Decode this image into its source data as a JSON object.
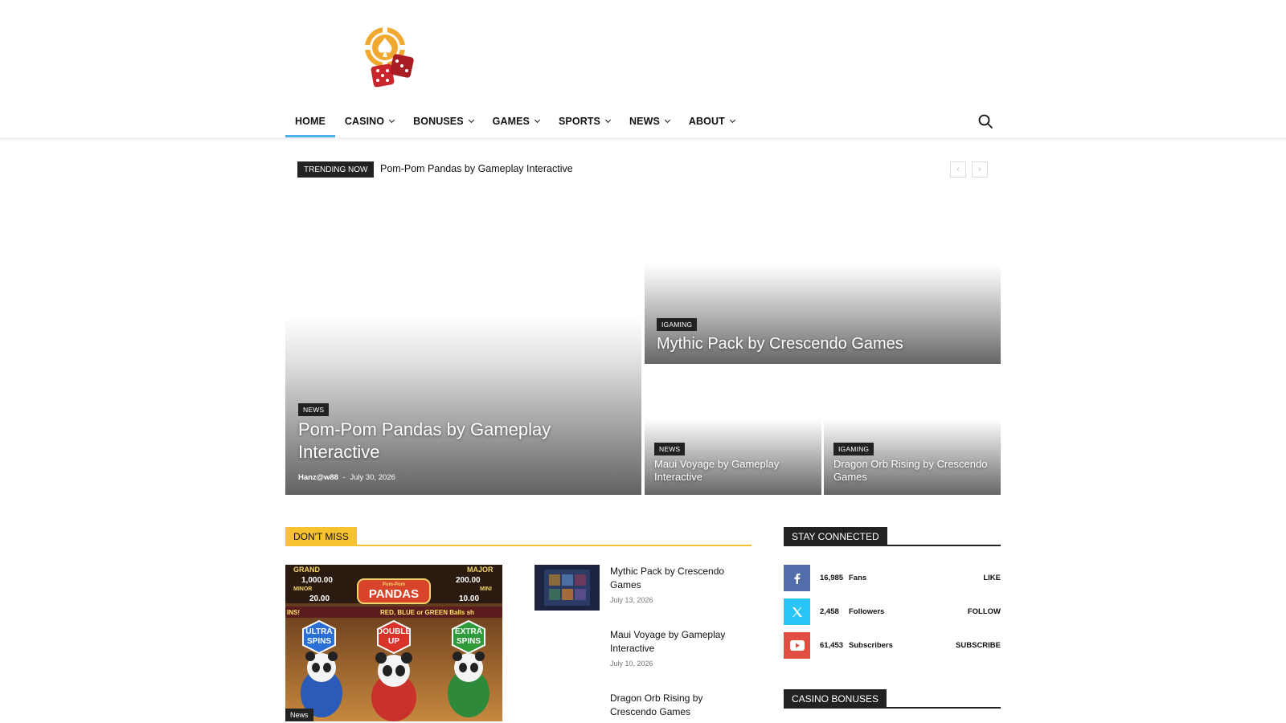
{
  "logo": {
    "icon": "casino-chip-dice-logo",
    "colors": {
      "chip": "#f0a830",
      "dice": "#c8252c"
    }
  },
  "nav": {
    "items": [
      {
        "label": "HOME",
        "dropdown": false,
        "active": true
      },
      {
        "label": "CASINO",
        "dropdown": true
      },
      {
        "label": "BONUSES",
        "dropdown": true
      },
      {
        "label": "GAMES",
        "dropdown": true
      },
      {
        "label": "SPORTS",
        "dropdown": true
      },
      {
        "label": "NEWS",
        "dropdown": true
      },
      {
        "label": "ABOUT",
        "dropdown": true
      }
    ],
    "accent": "#4db2ec"
  },
  "trending": {
    "label": "TRENDING NOW",
    "headline": "Pom-Pom Pandas by Gameplay Interactive",
    "prev": "‹",
    "next": "›"
  },
  "featured": {
    "big": {
      "category": "NEWS",
      "title": "Pom-Pom Pandas by Gameplay Interactive",
      "author": "Hanz@w88",
      "separator": "-",
      "date": "July 30, 2026"
    },
    "top": {
      "category": "IGAMING",
      "title": "Mythic Pack by Crescendo Games"
    },
    "small": [
      {
        "category": "NEWS",
        "title": "Maui Voyage by Gameplay Interactive"
      },
      {
        "category": "IGAMING",
        "title": "Dragon Orb Rising by Crescendo Games"
      }
    ]
  },
  "dont_miss": {
    "heading": "DON'T MISS",
    "accent": "#f7c22f",
    "feature_image": {
      "tag": "News",
      "art": {
        "grand_label": "GRAND",
        "grand_value": "1,000.00",
        "major_label": "MAJOR",
        "major_value": "200.00",
        "minor_label": "MINOR",
        "minor_value": "20.00",
        "mini_label": "MINI",
        "mini_value": "10.00",
        "logo_top": "Pom-Pom",
        "logo": "PANDAS",
        "banner_left": "INS!",
        "banner": "RED, BLUE or GREEN Balls sh",
        "badge_left": [
          "ULTRA",
          "SPINS"
        ],
        "badge_mid": [
          "DOUBLE",
          "UP"
        ],
        "badge_right": [
          "EXTRA",
          "SPINS"
        ]
      }
    },
    "list": [
      {
        "title": "Mythic Pack by Crescendo Games",
        "date": "July 13, 2026"
      },
      {
        "title": "Maui Voyage by Gameplay Interactive",
        "date": "July 10, 2026"
      },
      {
        "title": "Dragon Orb Rising by Crescendo Games",
        "date": ""
      }
    ]
  },
  "stay_connected": {
    "heading": "STAY CONNECTED",
    "items": [
      {
        "icon": "facebook-icon",
        "count": "16,985",
        "unit": "Fans",
        "action": "LIKE",
        "color": "#516eab"
      },
      {
        "icon": "x-twitter-icon",
        "count": "2,458",
        "unit": "Followers",
        "action": "FOLLOW",
        "color": "#29c5f6"
      },
      {
        "icon": "youtube-icon",
        "count": "61,453",
        "unit": "Subscribers",
        "action": "SUBSCRIBE",
        "color": "#e14e42"
      }
    ]
  },
  "casino_bonuses": {
    "heading": "CASINO BONUSES"
  }
}
